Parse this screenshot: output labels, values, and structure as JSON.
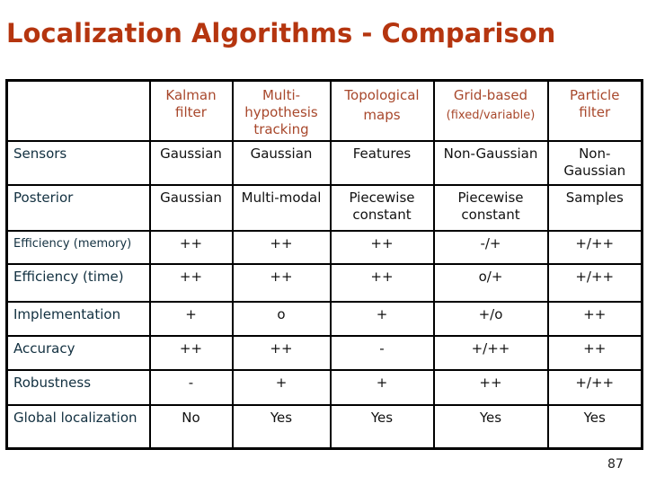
{
  "title": "Localization Algorithms - Comparison",
  "title_color": "#b5350f",
  "header_color": "#a8482c",
  "table": {
    "columns": [
      {
        "label": [
          "Kalman",
          "filter"
        ]
      },
      {
        "label": [
          "Multi-",
          "hypothesis",
          "tracking"
        ]
      },
      {
        "label": [
          "Topological",
          "maps"
        ]
      },
      {
        "label": [
          "Grid-based",
          "(fixed/variable)"
        ]
      },
      {
        "label": [
          "Particle",
          "filter"
        ]
      }
    ],
    "rows": [
      {
        "label": "Sensors",
        "cells": [
          [
            "Gaussian"
          ],
          [
            "Gaussian"
          ],
          [
            "Features"
          ],
          [
            "Non-Gaussian"
          ],
          [
            "Non-",
            "Gaussian"
          ]
        ]
      },
      {
        "label": "Posterior",
        "cells": [
          [
            "Gaussian"
          ],
          [
            "Multi-modal"
          ],
          [
            "Piecewise",
            "constant"
          ],
          [
            "Piecewise",
            "constant"
          ],
          [
            "Samples"
          ]
        ]
      },
      {
        "label": "Efficiency (memory)",
        "cells": [
          [
            "++"
          ],
          [
            "++"
          ],
          [
            "++"
          ],
          [
            "-/+"
          ],
          [
            "+/++"
          ]
        ]
      },
      {
        "label": "Efficiency (time)",
        "cells": [
          [
            "++"
          ],
          [
            "++"
          ],
          [
            "++"
          ],
          [
            "o/+"
          ],
          [
            "+/++"
          ]
        ]
      },
      {
        "label": "Implementation",
        "cells": [
          [
            "+"
          ],
          [
            "o"
          ],
          [
            "+"
          ],
          [
            "+/o"
          ],
          [
            "++"
          ]
        ]
      },
      {
        "label": "Accuracy",
        "cells": [
          [
            "++"
          ],
          [
            "++"
          ],
          [
            "-"
          ],
          [
            "+/++"
          ],
          [
            "++"
          ]
        ]
      },
      {
        "label": "Robustness",
        "cells": [
          [
            "-"
          ],
          [
            "+"
          ],
          [
            "+"
          ],
          [
            "++"
          ],
          [
            "+/++"
          ]
        ]
      },
      {
        "label": "Global localization",
        "cells": [
          [
            "No"
          ],
          [
            "Yes"
          ],
          [
            "Yes"
          ],
          [
            "Yes"
          ],
          [
            "Yes"
          ]
        ]
      }
    ]
  },
  "page_number": "87"
}
